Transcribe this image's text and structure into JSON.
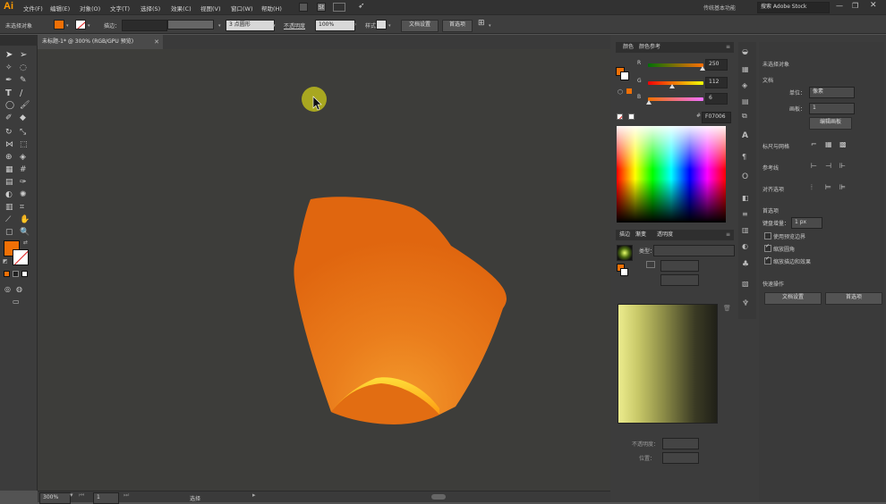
{
  "app": {
    "logo": "Ai"
  },
  "menu": {
    "items": [
      "文件(F)",
      "编辑(E)",
      "对象(O)",
      "文字(T)",
      "选择(S)",
      "效果(C)",
      "视图(V)",
      "窗口(W)",
      "帮助(H)"
    ],
    "workspace": "传统基本功能",
    "search_placeholder": "搜索 Adobe Stock"
  },
  "control_bar": {
    "selection_status": "未选择对象",
    "stroke_label": "描边：",
    "brush_label": "3 点圆形",
    "opacity_label": "不透明度",
    "opacity_value": "100%",
    "style_label": "样式：",
    "doc_setup_button": "文档设置",
    "prefs_button": "首选项"
  },
  "document_tab": {
    "title": "未标题-1* @ 300% (RGB/GPU 预览)",
    "close": "✕"
  },
  "status_bar": {
    "zoom": "300%",
    "artboard": "1",
    "tool": "选择"
  },
  "color_panel": {
    "tabs": [
      "颜色",
      "颜色参考"
    ],
    "channels": [
      {
        "label": "R",
        "value": "250",
        "level": 0.98
      },
      {
        "label": "G",
        "value": "112",
        "level": 0.44
      },
      {
        "label": "B",
        "value": "6",
        "level": 0.02
      }
    ],
    "hex": "F07006",
    "fill_color": "#f07006"
  },
  "gradient_panel": {
    "tabs": [
      "描边",
      "渐变",
      "透明度"
    ],
    "type_label": "类型：",
    "opacity_label": "不透明度：",
    "position_label": "位置："
  },
  "properties_panel": {
    "title": "未选择对象",
    "document_label": "文档",
    "units_label": "单位：",
    "units_value": "像素",
    "artboard_label": "画板：",
    "artboard_value": "1",
    "edit_artboard_button": "编辑画板",
    "rulers_label": "标尺与网格",
    "guides_label": "参考线",
    "snap_label": "对齐选项",
    "prefs_section": "首选项",
    "keyboard_increment_label": "键盘增量：",
    "keyboard_increment_value": "1 px",
    "options": [
      {
        "label": "使用预览边界",
        "checked": false
      },
      {
        "label": "缩放圆角",
        "checked": true
      },
      {
        "label": "缩放描边和效果",
        "checked": true
      }
    ],
    "quick_actions_label": "快速操作",
    "doc_setup_button": "文档设置",
    "prefs_button": "首选项"
  },
  "colors": {
    "accent": "#ff9a00",
    "lantern_orange": "#e06a12",
    "lantern_yellow": "#ffd21a",
    "cursor_highlight": "#b4b21e"
  }
}
